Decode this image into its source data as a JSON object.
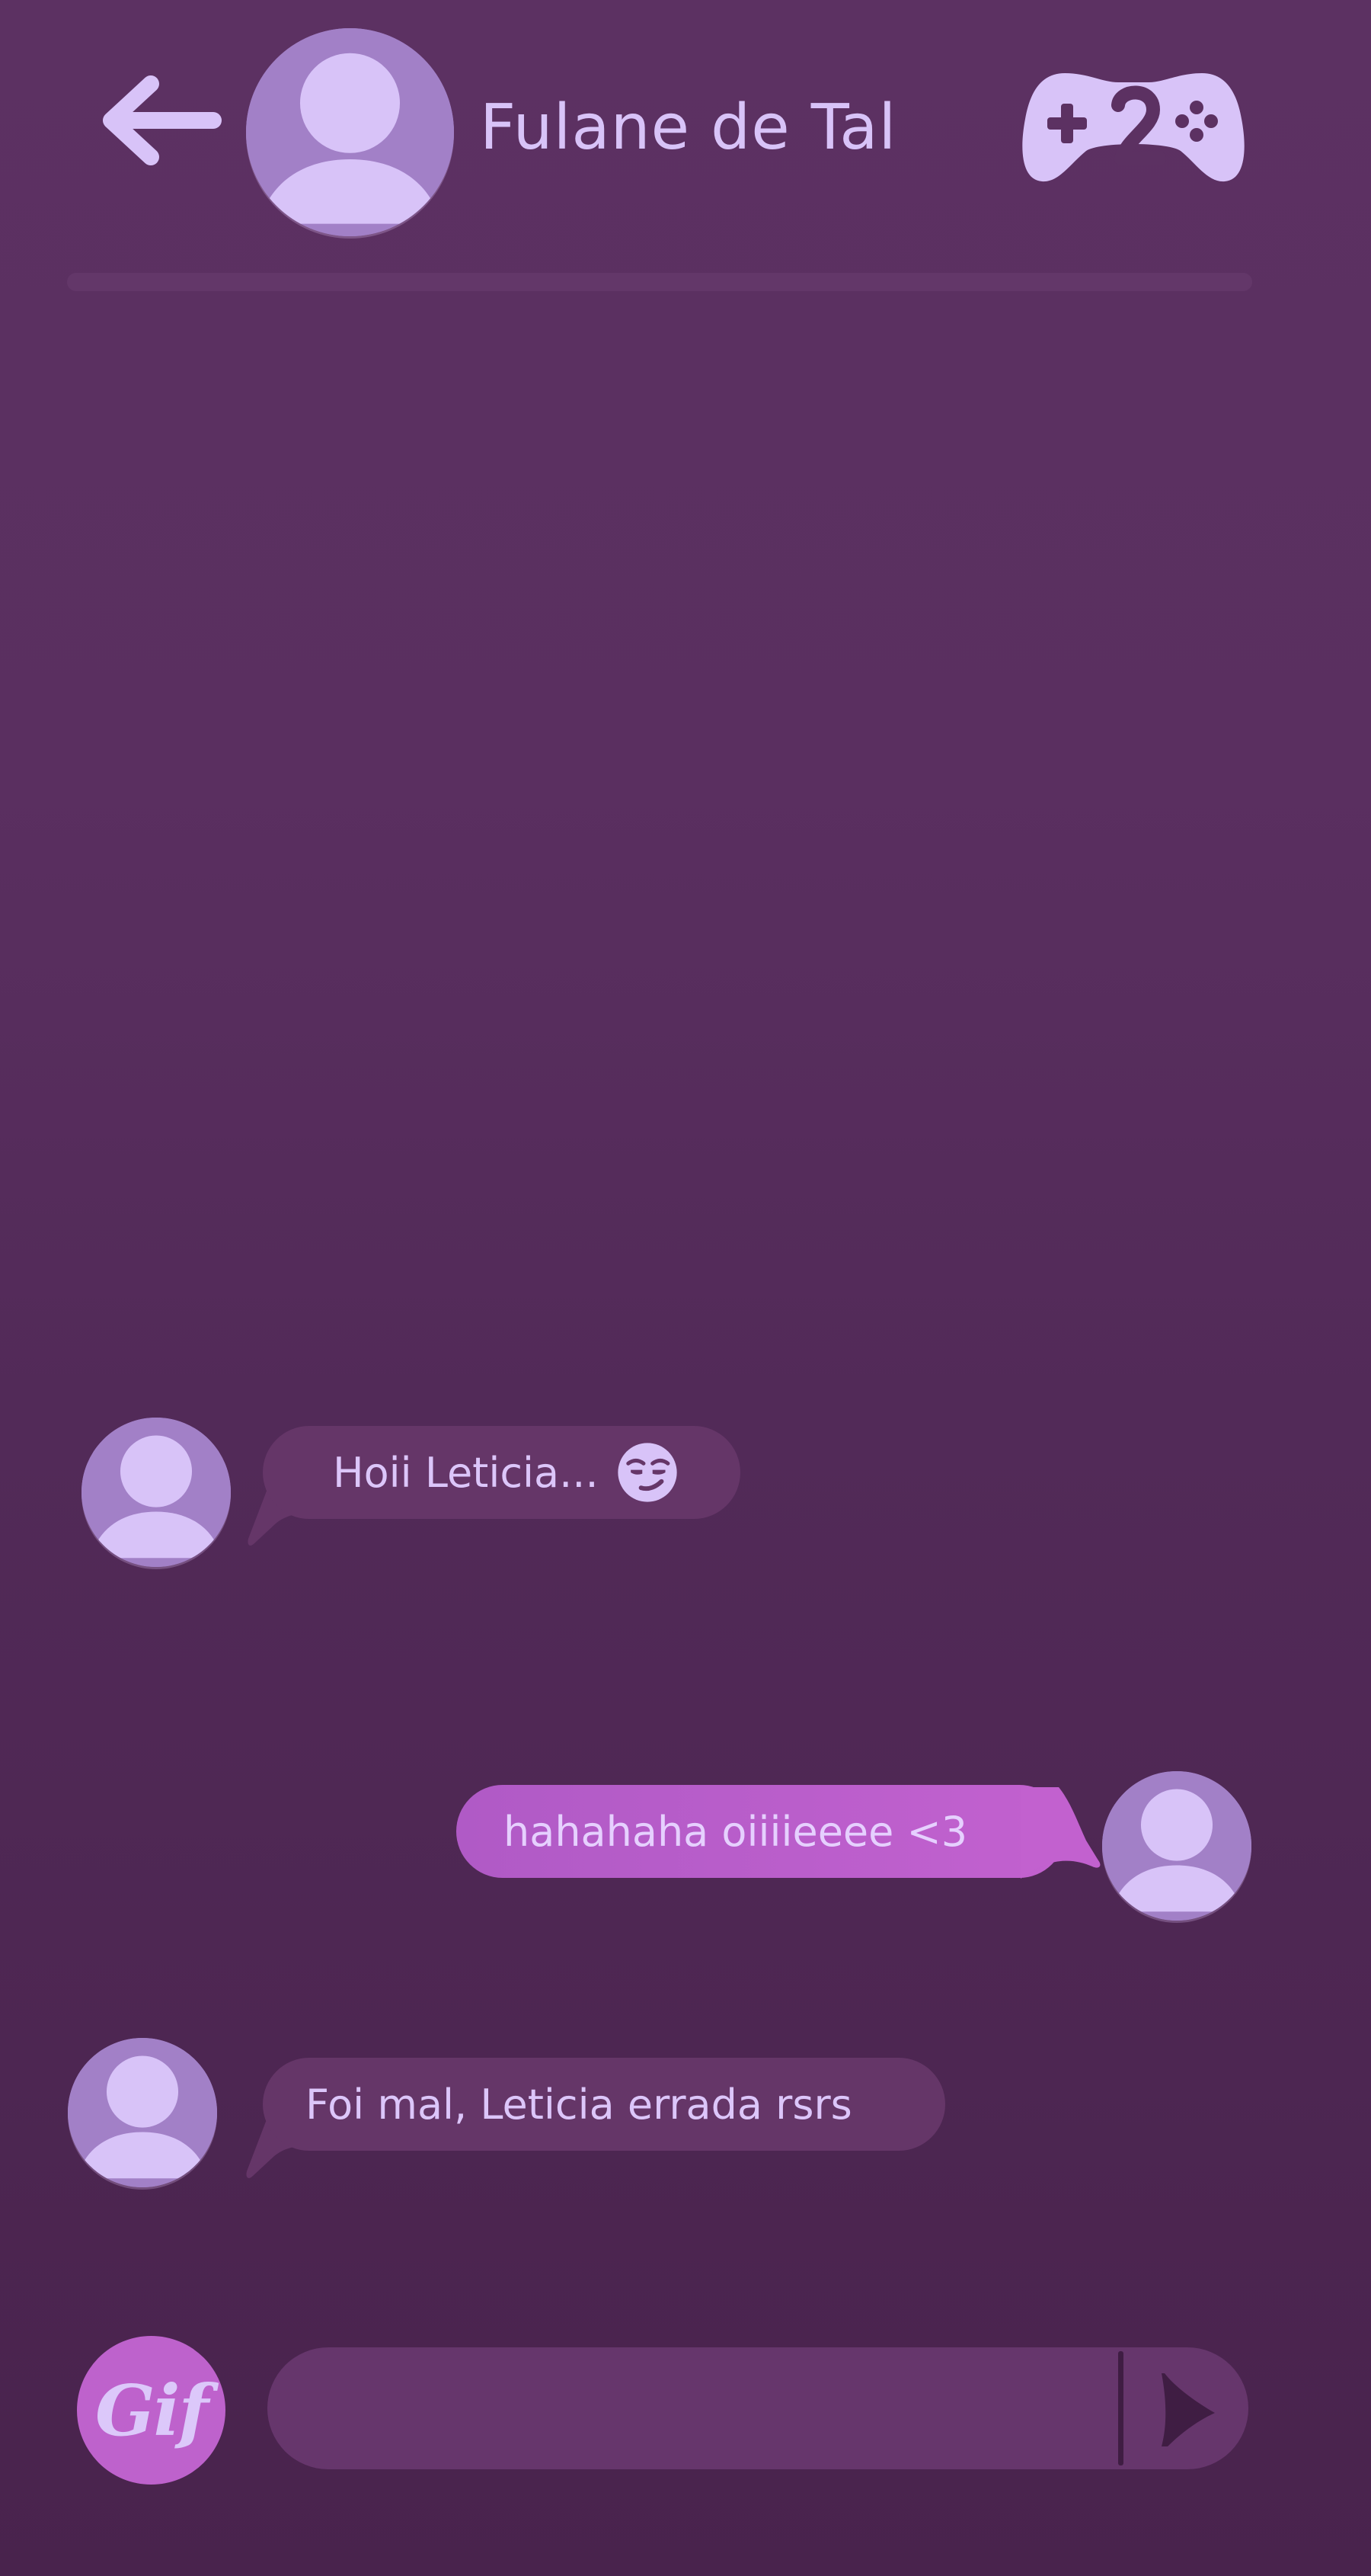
{
  "header": {
    "contact_name": "Fulane de Tal",
    "back_icon": "arrow-left-icon",
    "game_icon": "gamepad-2-icon",
    "avatar_icon": "user-avatar-icon"
  },
  "messages": [
    {
      "direction": "incoming",
      "text": "Hoii Leticia...",
      "emoji": "smirk-emoji-icon"
    },
    {
      "direction": "outgoing",
      "text": "hahahaha oiiiieeee <3"
    },
    {
      "direction": "incoming",
      "text": "Foi mal, Leticia errada rsrs"
    }
  ],
  "composer": {
    "gif_label": "Gif",
    "input_value": "",
    "placeholder": "",
    "send_icon": "send-arrow-icon"
  },
  "colors": {
    "background": "#5c3162",
    "avatar": "#a280c7",
    "avatar_figure": "#d8c3f8",
    "incoming_bubble": "#653668",
    "outgoing_bubble": "#c261cf",
    "text": "#dcc6fa"
  }
}
